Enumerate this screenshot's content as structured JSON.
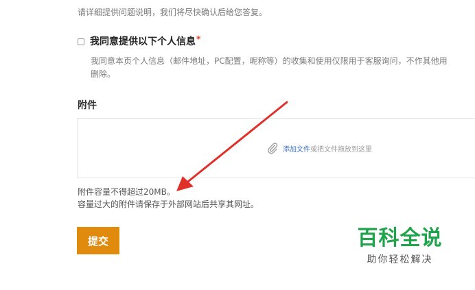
{
  "form": {
    "hint": "请详细提供问题说明，我们将尽快确认后给您答复。",
    "consent_title": "我同意提供以下个人信息",
    "required_mark": "*",
    "consent_desc_line1": "我同意本页个人信息（邮件地址，PC配置，昵称等）的收集和使用仅限用于客服询问，不作其他用",
    "consent_desc_line2": "删除。",
    "attachment_label": "附件",
    "dropzone_link": "添加文件",
    "dropzone_text": "或把文件拖放到这里",
    "limit_line1": "附件容量不得超过20MB。",
    "limit_line2": "容量过大的附件请保存于外部网站后共享其网址。",
    "submit_label": "提交"
  },
  "watermark": {
    "title": "百科全说",
    "subtitle": "助你轻松解决"
  },
  "colors": {
    "submit_bg": "#e08a0e",
    "arrow": "#e0302a",
    "watermark_green": "#1fa34b",
    "link_blue": "#3b70c5"
  },
  "icons": {
    "attachment": "paperclip-icon",
    "annotation": "red-arrow"
  }
}
